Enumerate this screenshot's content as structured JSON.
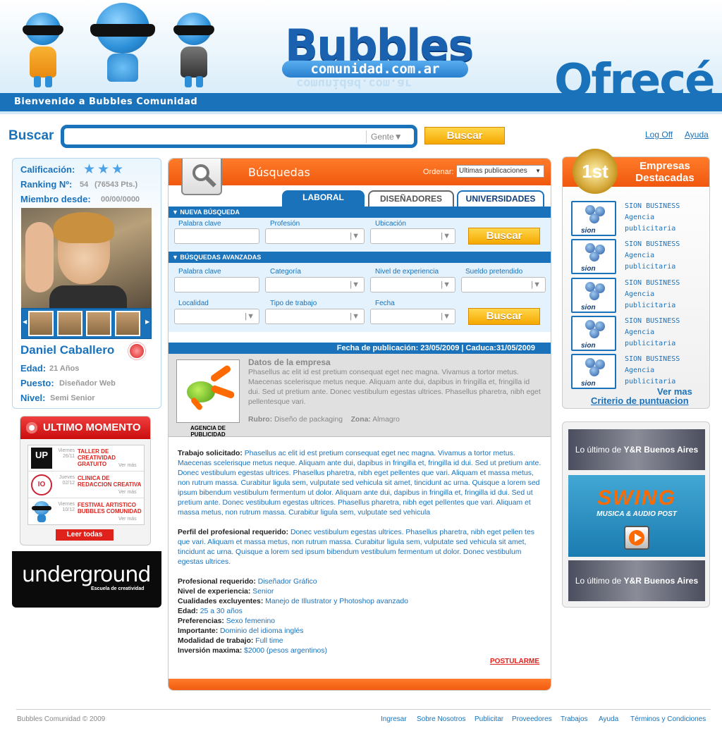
{
  "header": {
    "welcome": "Bienvenido a Bubbles Comunidad",
    "logo_title": "Bubbles",
    "logo_domain": "comunidad.com.ar",
    "promo_text": "Ofrecé"
  },
  "search": {
    "label": "Buscar",
    "placeholder": "",
    "category": "Gente",
    "button": "Buscar"
  },
  "top_links": {
    "logout": "Log Off",
    "help": "Ayuda"
  },
  "profile": {
    "rating_label": "Calificación:",
    "ranking_label": "Ranking Nº:",
    "ranking_value": "54",
    "points": "(76543 Pts.)",
    "member_label": "Miembro desde:",
    "member_value": "00/00/0000",
    "name": "Daniel Caballero",
    "age_label": "Edad:",
    "age_value": "21 Años",
    "position_label": "Puesto:",
    "position_value": "Diseñador Web",
    "level_label": "Nivel:",
    "level_value": "Semi Senior",
    "stars": 3
  },
  "ultimo": {
    "title": "ULTIMO MOMENTO",
    "events": [
      {
        "day": "Viernes",
        "date": "26/11",
        "title": "TALLER DE CREATIVIDAD GRATUITO",
        "more": "Ver más",
        "icon": "up-logo-icon",
        "icon_text": "UP"
      },
      {
        "day": "Jueves",
        "date": "02/12",
        "title": "CLINICA DE REDACCION CREATIVA",
        "more": "Ver más",
        "icon": "io-seal-icon",
        "icon_text": "IO"
      },
      {
        "day": "Viernes",
        "date": "10/12",
        "title": "FESTIVAL ARTISTICO BUBBLES COMUNIDAD",
        "more": "Ver más",
        "icon": "bubble-mascot-icon"
      }
    ],
    "read_all": "Leer todas"
  },
  "underground": {
    "title": "underground",
    "subtitle": "Escuela de creatividad"
  },
  "busquedas": {
    "title": "Búsquedas",
    "order_label": "Ordenar:",
    "order_value": "Ultimas publicaciones",
    "tabs": [
      "LABORAL",
      "DISEÑADORES",
      "UNIVERSIDADES"
    ],
    "nueva": {
      "title": "NUEVA BÚSQUEDA",
      "fields": [
        "Palabra clave",
        "Profesión",
        "Ubicación"
      ],
      "button": "Buscar"
    },
    "avanzadas": {
      "title": "BÚSQUEDAS AVANZADAS",
      "fields_row1": [
        "Palabra clave",
        "Categoría",
        "Nivel de experiencia",
        "Sueldo pretendido"
      ],
      "fields_row2": [
        "Localidad",
        "Tipo de trabajo",
        "Fecha"
      ],
      "button": "Buscar"
    }
  },
  "publication": {
    "bar": "Fecha de publicación: 23/05/2009   |   Caduca:31/05/2009",
    "logo_caption": "AGENCIA DE PUBLICIDAD",
    "company_title": "Datos de la empresa",
    "company_text": "Phasellus ac elit id est pretium consequat eget nec magna. Vivamus a tortor metus. Maecenas scelerisque metus neque. Aliquam ante dui, dapibus in fringilla et, fringilla id dui. Sed ut pretium ante. Donec vestibulum egestas ultrices. Phasellus pharetra, nibh eget pellentesque vari.",
    "rubro_label": "Rubro:",
    "rubro_value": "Diseño de packaging",
    "zona_label": "Zona:",
    "zona_value": "Almagro",
    "trabajo_label": "Trabajo solicitado:",
    "trabajo_text": "Phasellus ac elit id est pretium consequat eget nec magna. Vivamus a tortor metus. Maecenas scelerisque metus neque. Aliquam ante dui, dapibus in fringilla et, fringilla id dui. Sed ut pretium ante. Donec vestibulum egestas ultrices. Phasellus pharetra, nibh eget pellentes que vari. Aliquam et massa metus, non rutrum massa. Curabitur ligula sem, vulputate sed vehicula sit amet, tincidunt ac urna. Quisque a lorem sed ipsum bibendum vestibulum fermentum ut dolor. Aliquam ante dui, dapibus in fringilla et, fringilla id dui. Sed ut pretium ante. Donec vestibulum egestas ultrices. Phasellus pharetra, nibh eget pellentes que vari. Aliquam et massa metus, non rutrum massa. Curabitur ligula sem, vulputate sed vehicula",
    "perfil_label": "Perfil del profesional requerido:",
    "perfil_text": "Donec vestibulum egestas ultrices. Phasellus pharetra, nibh eget pellen tes que vari. Aliquam et massa metus, non rutrum massa. Curabitur ligula sem, vulputate sed vehicula sit amet, tincidunt ac urna. Quisque a lorem sed ipsum bibendum vestibulum fermentum ut dolor. Donec vestibulum egestas ultrices.",
    "details": [
      {
        "label": "Profesional requerido:",
        "value": "Diseñador Gráfico"
      },
      {
        "label": "Nivel de experiencia:",
        "value": "Senior"
      },
      {
        "label": "Cualidades excluyentes:",
        "value": "Manejo de Illustrator y Photoshop avanzado"
      },
      {
        "label": "Edad:",
        "value": "25 a 30 años"
      },
      {
        "label": "Preferencias:",
        "value": "Sexo femenino"
      },
      {
        "label": "Importante:",
        "value": "Dominio del idioma inglés"
      },
      {
        "label": "Modalidad de trabajo:",
        "value": "Full time"
      },
      {
        "label": "Inversión maxima:",
        "value": "$2000 (pesos argentinos)"
      }
    ],
    "apply": "POSTULARME"
  },
  "empresas": {
    "title": "Empresas Destacadas",
    "medal": "1st",
    "items": [
      {
        "logo": "sion",
        "name": "SION BUSINESS",
        "type": "Agencia publicitaria"
      },
      {
        "logo": "sion",
        "name": "SION BUSINESS",
        "type": "Agencia publicitaria"
      },
      {
        "logo": "sion",
        "name": "SION BUSINESS",
        "type": "Agencia publicitaria"
      },
      {
        "logo": "sion",
        "name": "SION BUSINESS",
        "type": "Agencia publicitaria"
      },
      {
        "logo": "sion",
        "name": "SION BUSINESS",
        "type": "Agencia publicitaria"
      }
    ],
    "more": "Ver mas",
    "criteria": "Criterio de puntuacion"
  },
  "banners": {
    "yr1_prefix": "Lo último de",
    "yr1_name": "Y&R Buenos Aires",
    "swing_title": "SWING",
    "swing_sub": "MUSICA & AUDIO POST",
    "yr2_prefix": "Lo último de",
    "yr2_name": "Y&R Buenos Aires"
  },
  "footer": {
    "copyright": "Bubbles Comunidad  © 2009",
    "links": [
      "Ingresar",
      "Sobre Nosotros",
      "Publicitar",
      "Proveedores",
      "Trabajos",
      "Ayuda",
      "Términos y Condiciones"
    ]
  },
  "colors": {
    "brand_blue": "#1a72bb",
    "accent_orange": "#f0580e",
    "alert_red": "#e0221c",
    "button_yellow": "#f5a800"
  }
}
